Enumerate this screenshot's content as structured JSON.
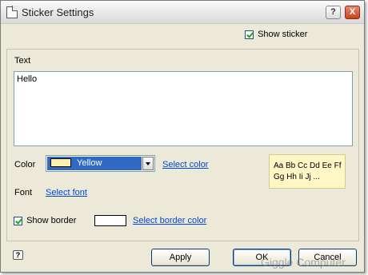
{
  "window": {
    "title": "Sticker Settings"
  },
  "titlebar_buttons": {
    "help": "?",
    "close": "X"
  },
  "show_sticker": {
    "label": "Show sticker",
    "checked": true
  },
  "text_section": {
    "label": "Text",
    "value": "Hello"
  },
  "color": {
    "label": "Color",
    "selected": "Yellow",
    "swatch_color": "#fff0b0",
    "select_link": "Select color"
  },
  "font": {
    "label": "Font",
    "select_link": "Select font"
  },
  "preview": {
    "line1": "Aa Bb Cc Dd Ee Ff",
    "line2": "Gg Hh Ii Jj ..."
  },
  "show_border": {
    "label": "Show border",
    "checked": true,
    "select_link": "Select border color"
  },
  "buttons": {
    "apply": "Apply",
    "ok": "OK",
    "cancel": "Cancel"
  },
  "watermark": "Giggle Computer",
  "colors": {
    "selection": "#316ac5",
    "link": "#0046d5",
    "preview_bg": "#fff8c6"
  }
}
